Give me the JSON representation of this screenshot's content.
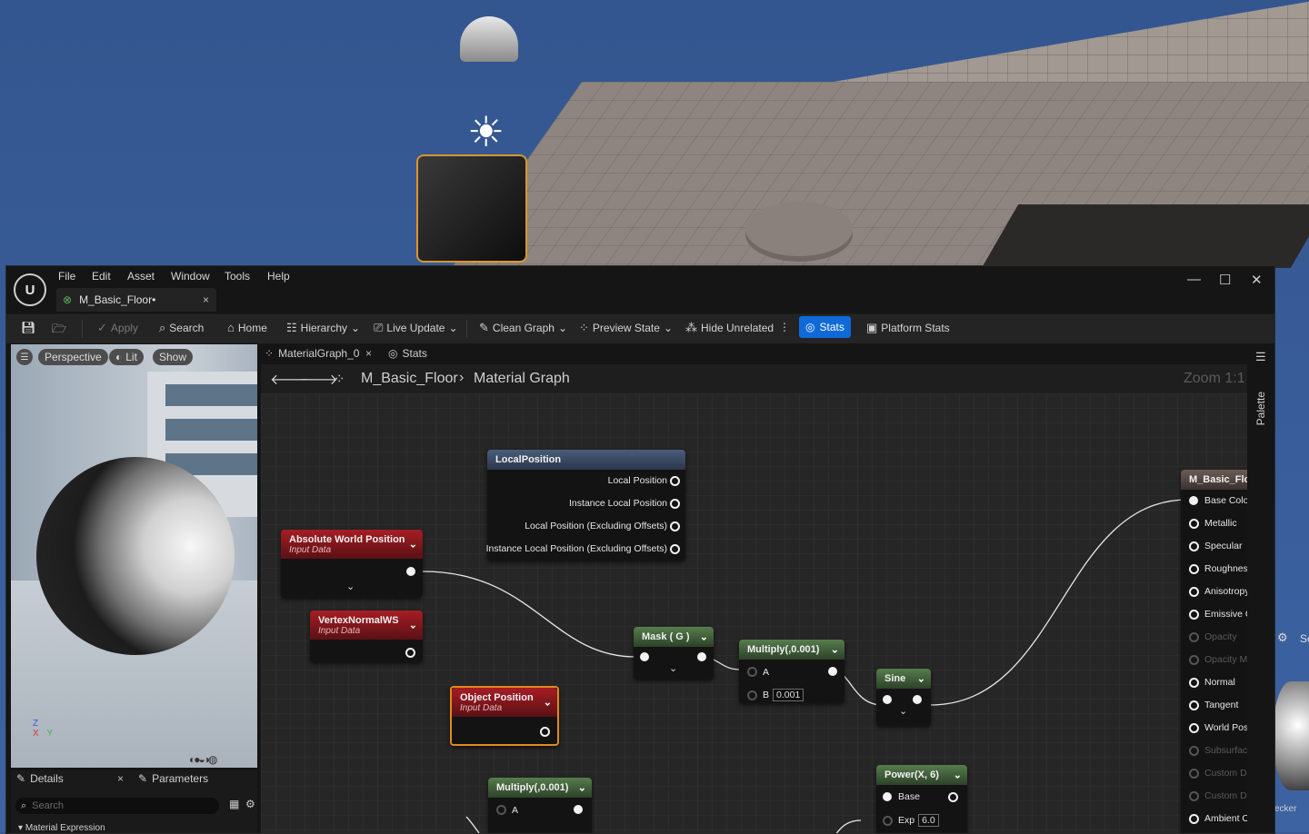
{
  "menu": [
    "File",
    "Edit",
    "Asset",
    "Window",
    "Tools",
    "Help"
  ],
  "document_tab": {
    "title": "M_Basic_Floor•",
    "close": "×"
  },
  "window_controls": {
    "minimize": "—",
    "maximize": "☐",
    "close": "✕"
  },
  "toolbar": {
    "apply": "Apply",
    "search": "Search",
    "home": "Home",
    "hierarchy": "Hierarchy",
    "live_update": "Live Update",
    "clean_graph": "Clean Graph",
    "preview_state": "Preview State",
    "hide_unrelated": "Hide Unrelated",
    "stats": "Stats",
    "platform_stats": "Platform Stats"
  },
  "viewport": {
    "perspective": "Perspective",
    "lit": "Lit",
    "show": "Show",
    "axis_z": "Z",
    "axis_x": "X",
    "axis_y": "Y"
  },
  "panel_tabs": {
    "details": "Details",
    "details_close": "×",
    "parameters": "Parameters"
  },
  "details": {
    "search_placeholder": "Search",
    "section": "Material Expression"
  },
  "graph_tabs": {
    "graph": "MaterialGraph_0",
    "graph_close": "×",
    "stats": "Stats"
  },
  "breadcrumb": {
    "asset": "M_Basic_Floor",
    "graph": "Material Graph",
    "zoom": "Zoom 1:1"
  },
  "palette_label": "Palette",
  "nodes": {
    "local_position": {
      "title": "LocalPosition",
      "outputs": [
        "Local Position",
        "Instance Local Position",
        "Local Position (Excluding Offsets)",
        "Instance Local Position (Excluding Offsets)"
      ]
    },
    "abs_world_pos": {
      "title": "Absolute World Position",
      "subtitle": "Input Data"
    },
    "vertex_normal": {
      "title": "VertexNormalWS",
      "subtitle": "Input Data"
    },
    "object_position": {
      "title": "Object Position",
      "subtitle": "Input Data"
    },
    "mask": {
      "title": "Mask ( G )"
    },
    "multiply1": {
      "title": "Multiply(,0.001)",
      "in_a": "A",
      "in_b": "B",
      "b_value": "0.001"
    },
    "sine": {
      "title": "Sine"
    },
    "multiply2": {
      "title": "Multiply(,0.001)",
      "in_a": "A"
    },
    "power": {
      "title": "Power(X, 6)",
      "base": "Base",
      "exp": "Exp",
      "exp_value": "6.0"
    },
    "result": {
      "title": "M_Basic_Floor",
      "inputs": [
        {
          "label": "Base Color",
          "enabled": true
        },
        {
          "label": "Metallic",
          "enabled": true
        },
        {
          "label": "Specular",
          "enabled": true
        },
        {
          "label": "Roughness",
          "enabled": true
        },
        {
          "label": "Anisotropy",
          "enabled": true
        },
        {
          "label": "Emissive Co",
          "enabled": true
        },
        {
          "label": "Opacity",
          "enabled": false
        },
        {
          "label": "Opacity Mas",
          "enabled": false
        },
        {
          "label": "Normal",
          "enabled": true
        },
        {
          "label": "Tangent",
          "enabled": true
        },
        {
          "label": "World Positi",
          "enabled": true
        },
        {
          "label": "Subsurface (",
          "enabled": false
        },
        {
          "label": "Custom Data",
          "enabled": false
        },
        {
          "label": "Custom Data",
          "enabled": false
        },
        {
          "label": "Ambient Occ",
          "enabled": true
        }
      ]
    }
  },
  "background_panel": {
    "label_partial": "Se",
    "checker_label": "ecker"
  },
  "colors": {
    "accent": "#0f6ad8",
    "selection": "#e08a1e",
    "node_red": "#a61d24",
    "node_green": "#567d4c"
  }
}
